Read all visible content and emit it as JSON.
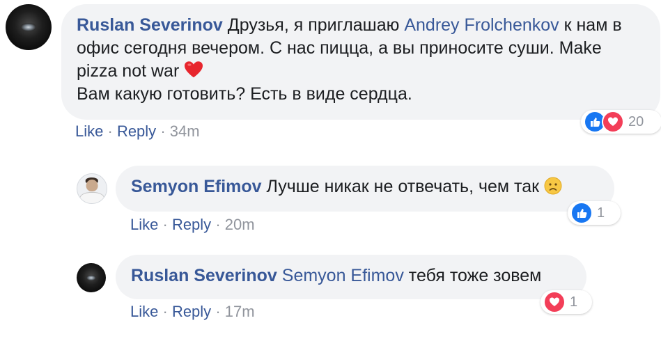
{
  "comments": [
    {
      "author": "Ruslan Severinov",
      "text_part1": "Друзья, я приглашаю ",
      "mention": "Andrey Frolchenkov",
      "text_part2": " к нам в офис сегодня вечером. С нас пицца, а вы приносите суши. Make pizza not war ",
      "text_line2": "Вам какую готовить? Есть в виде сердца.",
      "like_label": "Like",
      "reply_label": "Reply",
      "time": "34m",
      "reaction_count": "20",
      "reaction_icons": [
        "like-icon",
        "love-icon"
      ]
    }
  ],
  "replies": [
    {
      "author": "Semyon Efimov",
      "text": "Лучше никак не отвечать, чем так ",
      "like_label": "Like",
      "reply_label": "Reply",
      "time": "20m",
      "reaction_count": "1",
      "reaction_icons": [
        "like-icon"
      ]
    },
    {
      "author": "Ruslan Severinov",
      "mention": "Semyon Efimov",
      "text": " тебя тоже зовем",
      "like_label": "Like",
      "reply_label": "Reply",
      "time": "17m",
      "reaction_count": "1",
      "reaction_icons": [
        "love-icon"
      ]
    }
  ],
  "separator": "·",
  "colors": {
    "author": "#385898",
    "bubble": "#f2f3f5",
    "meta": "#90949c",
    "like": "#1877f2",
    "love": "#f33e58"
  }
}
